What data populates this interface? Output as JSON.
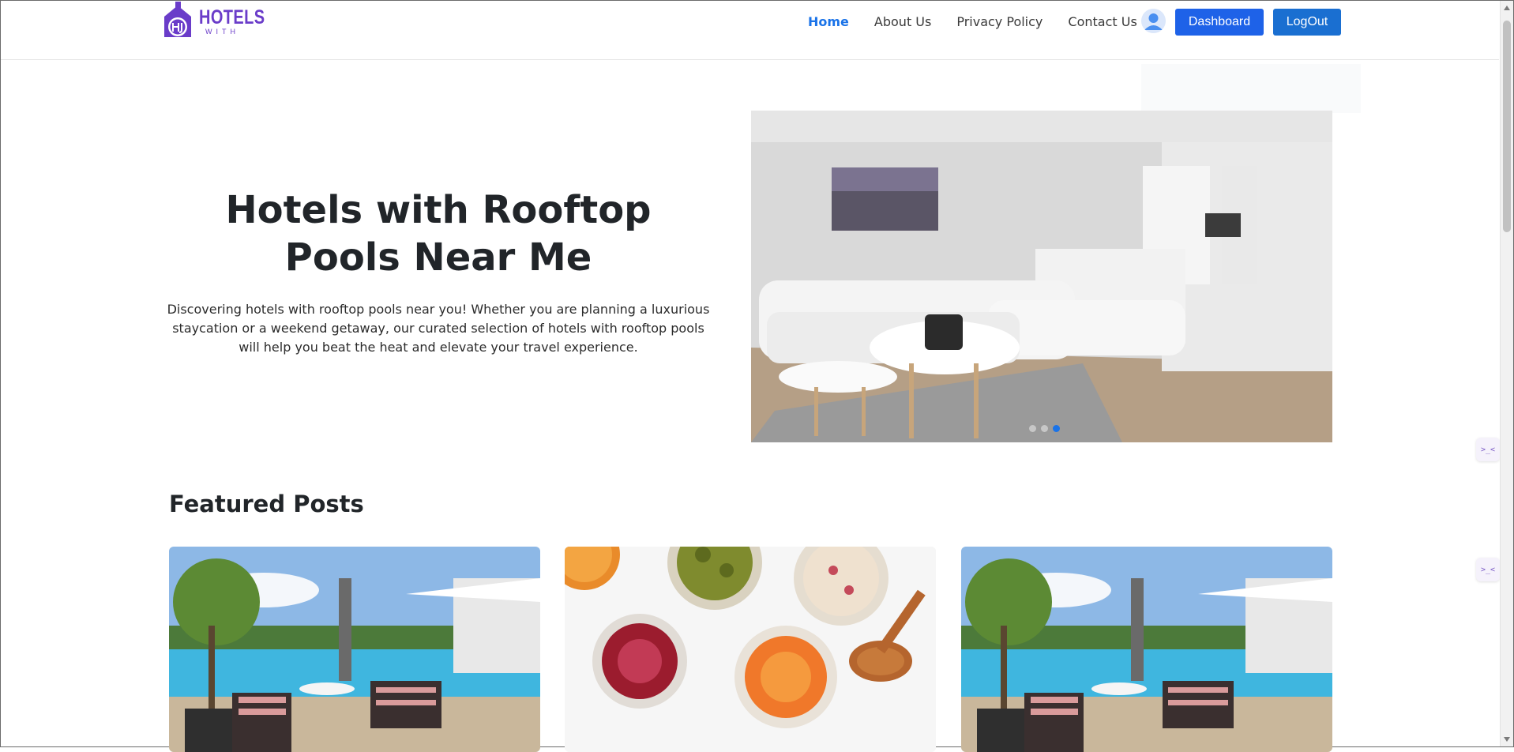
{
  "header": {
    "logo": {
      "word": "HOTELS",
      "sub": "WITH"
    },
    "nav": [
      {
        "label": "Home",
        "active": true
      },
      {
        "label": "About Us",
        "active": false
      },
      {
        "label": "Privacy Policy",
        "active": false
      },
      {
        "label": "Contact Us",
        "active": false
      }
    ],
    "dashboard_label": "Dashboard",
    "logout_label": "LogOut"
  },
  "hero": {
    "title": "Hotels with Rooftop Pools Near Me",
    "description": "Discovering hotels with rooftop pools near you! Whether you are planning a luxurious staycation or a weekend getaway, our curated selection of hotels with rooftop pools will help you beat the heat and elevate your travel experience.",
    "carousel_total": 3,
    "carousel_active": 3
  },
  "featured": {
    "title": "Featured Posts",
    "cards": [
      {
        "image": "pool-patio-photo"
      },
      {
        "image": "pickled-jars-photo"
      },
      {
        "image": "pool-patio-photo"
      }
    ]
  },
  "colors": {
    "accent": "#1a73e8",
    "brand": "#6a3cc9",
    "dashboard": "#1e62e8",
    "logout": "#1a6fd1"
  }
}
